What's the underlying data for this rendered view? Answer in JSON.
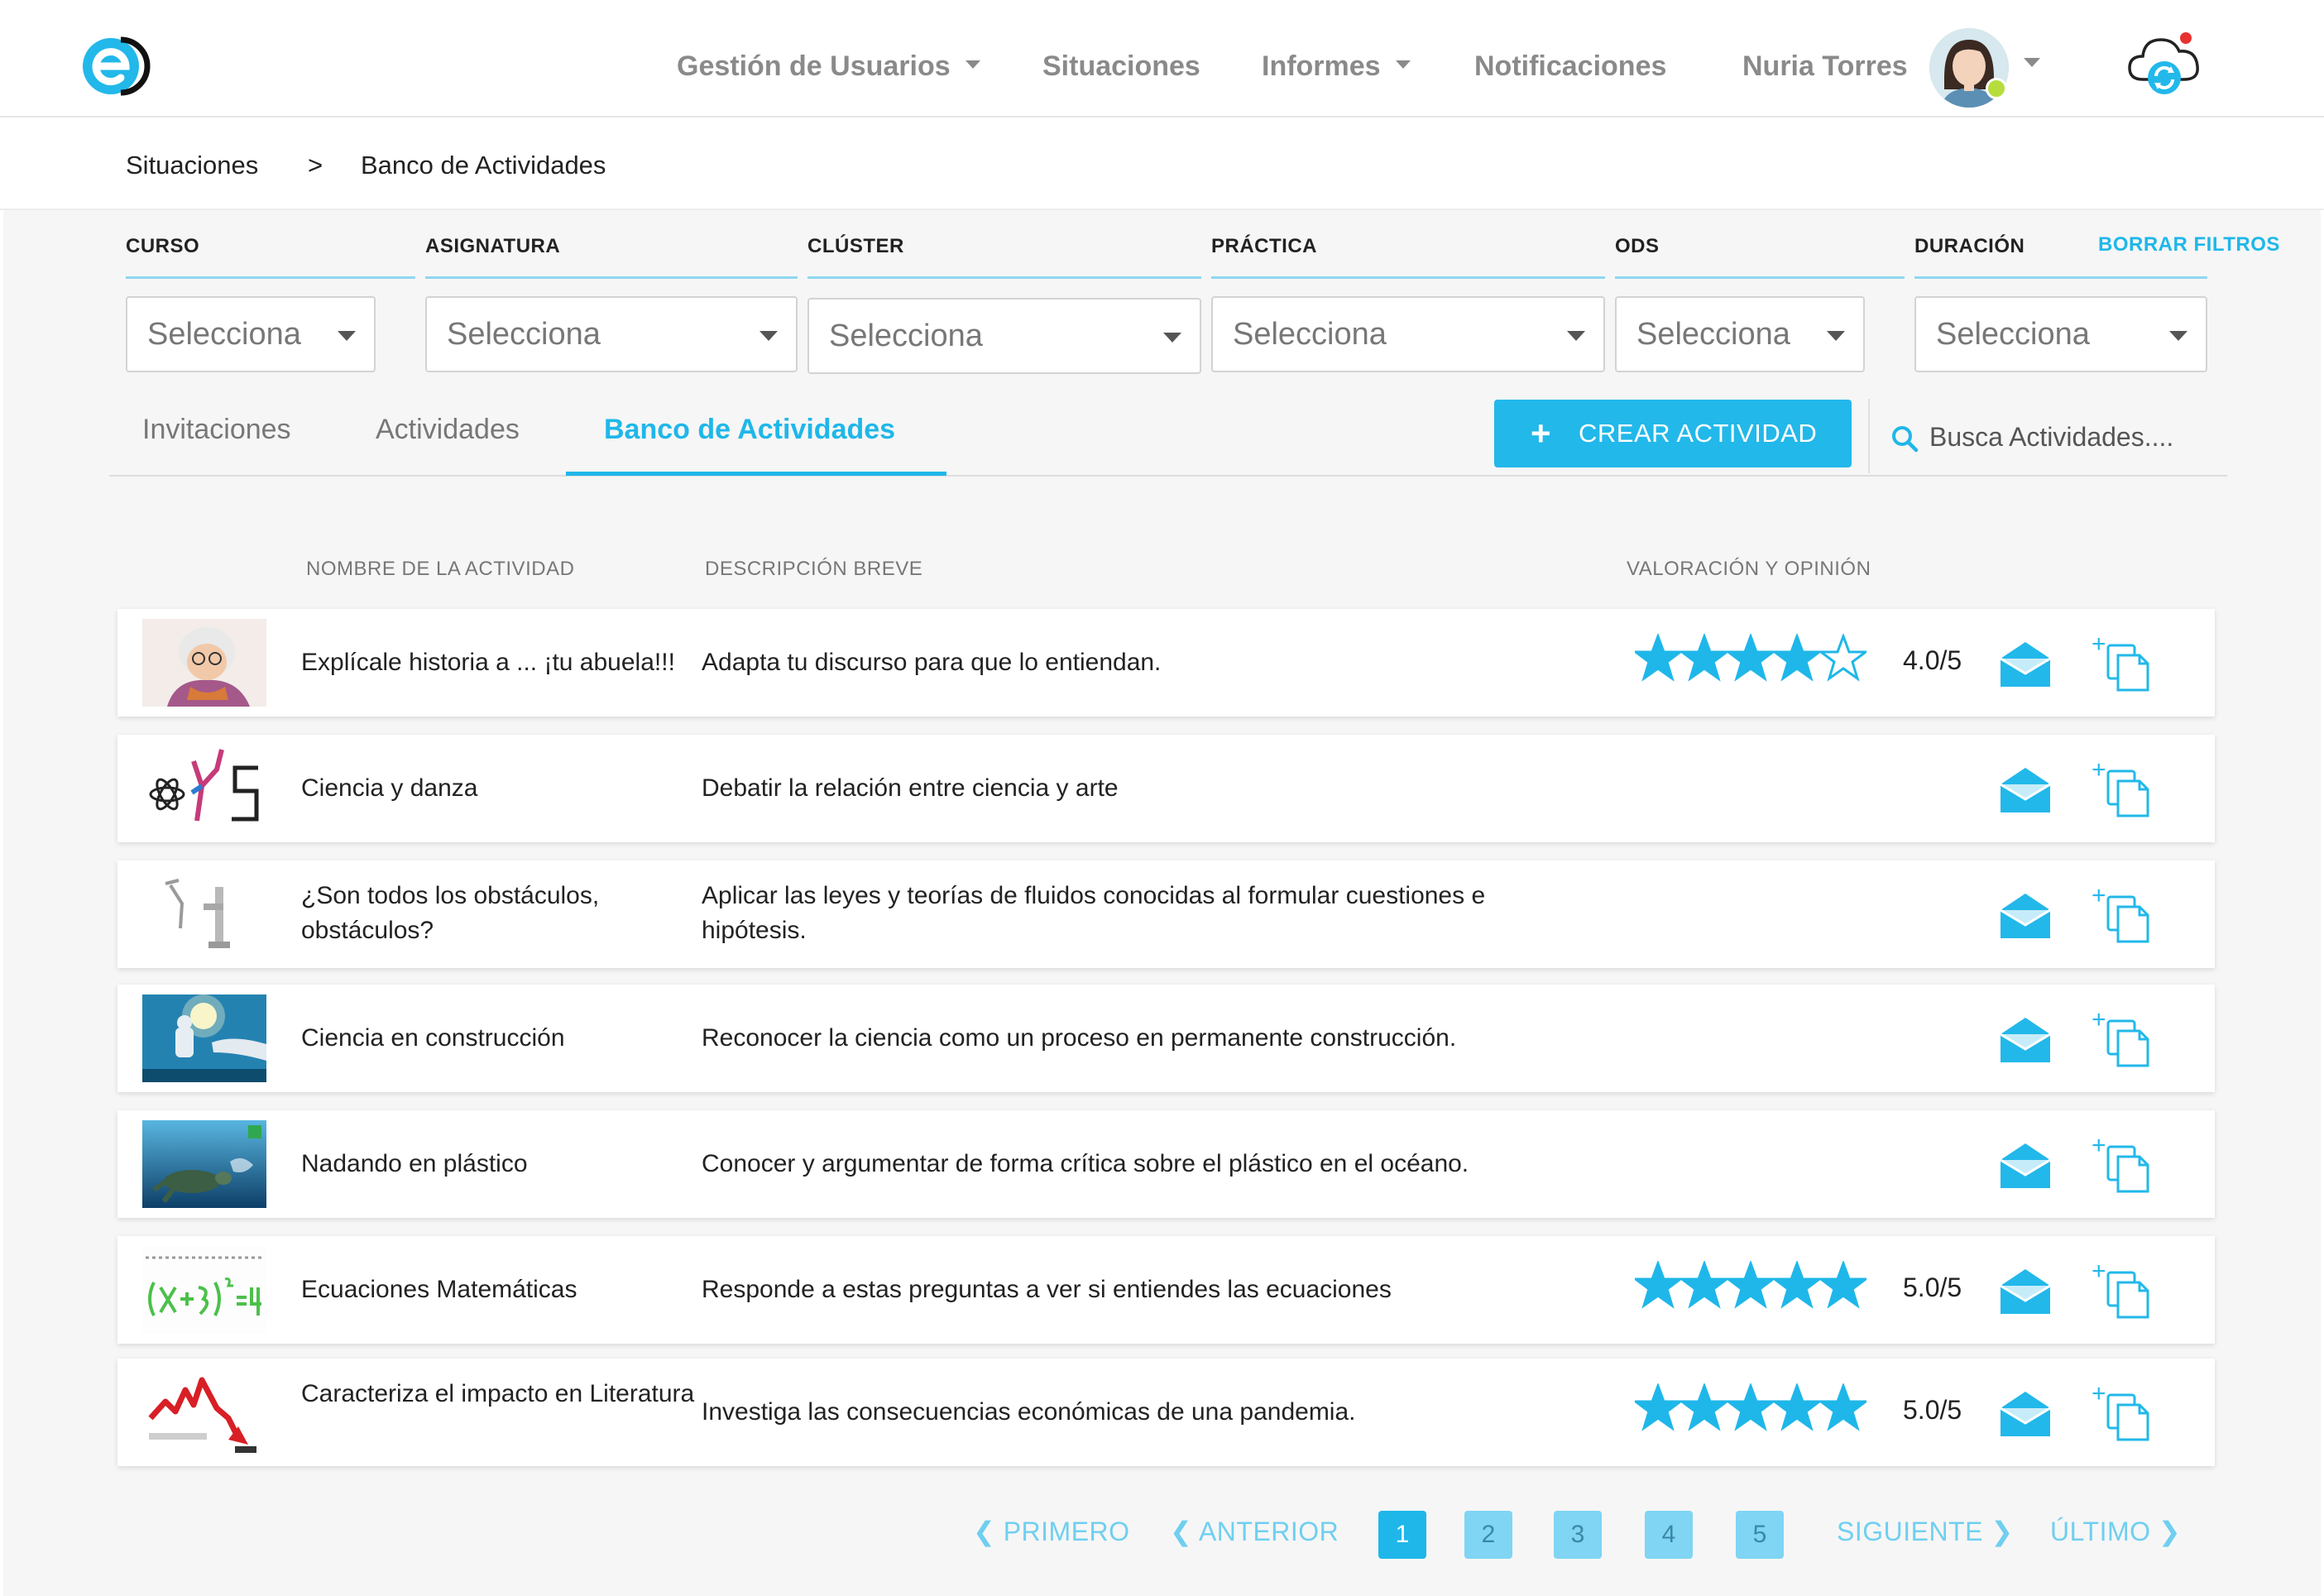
{
  "nav": {
    "items": [
      {
        "label": "Gestión de Usuarios",
        "dropdown": true
      },
      {
        "label": "Situaciones",
        "dropdown": false
      },
      {
        "label": "Informes",
        "dropdown": true
      },
      {
        "label": "Notificaciones",
        "dropdown": false
      }
    ],
    "user_name": "Nuria Torres"
  },
  "breadcrumb": {
    "items": [
      "Situaciones",
      ">",
      "Banco de Actividades"
    ]
  },
  "filters": {
    "labels": [
      "CURSO",
      "ASIGNATURA",
      "CLÚSTER",
      "PRÁCTICA",
      "ODS",
      "DURACIÓN"
    ],
    "placeholder": "Selecciona",
    "clear_label": "BORRAR FILTROS"
  },
  "tabs": {
    "items": [
      "Invitaciones",
      "Actividades",
      "Banco de Actividades"
    ],
    "active": "Banco de Actividades"
  },
  "toolbar": {
    "create_label": "CREAR ACTIVIDAD",
    "search_placeholder": "Busca Actividades...."
  },
  "table": {
    "headers": {
      "name": "NOMBRE DE LA ACTIVIDAD",
      "description": "DESCRIPCIÓN BREVE",
      "rating": "VALORACIÓN Y OPINIÓN"
    },
    "rows": [
      {
        "name": "Explícale historia a ... ¡tu abuela!!!",
        "description": "Adapta tu discurso para que lo entiendan.",
        "rating": 4,
        "rating_label": "4.0/5",
        "thumb": "grandmother-image"
      },
      {
        "name": "Ciencia y danza",
        "description": "Debatir la relación entre ciencia y arte",
        "rating": null,
        "rating_label": "",
        "thumb": "science-dance-image"
      },
      {
        "name": "¿Son todos los obstáculos, obstáculos?",
        "description": "Aplicar las leyes y teorías de fluidos conocidas al formular cuestiones e hipótesis.",
        "rating": null,
        "rating_label": "",
        "thumb": "faucet-image"
      },
      {
        "name": "Ciencia en construcción",
        "description": "Reconocer la ciencia como un proceso en permanente construcción.",
        "rating": null,
        "rating_label": "",
        "thumb": "robot-lightbulb-image"
      },
      {
        "name": "Nadando en plástico",
        "description": "Conocer y argumentar de forma crítica sobre el plástico en el océano.",
        "rating": null,
        "rating_label": "",
        "thumb": "turtle-plastic-image"
      },
      {
        "name": "Ecuaciones Matemáticas",
        "description": "Responde a estas preguntas a ver si entiendes las ecuaciones",
        "rating": 5,
        "rating_label": "5.0/5",
        "thumb": "equation-image"
      },
      {
        "name": "Caracteriza el impacto en Literatura",
        "description": "Investiga las consecuencias económicas de una pandemia.",
        "rating": 5,
        "rating_label": "5.0/5",
        "thumb": "falling-chart-image"
      }
    ]
  },
  "pagination": {
    "first": "PRIMERO",
    "prev": "ANTERIOR",
    "pages": [
      "1",
      "2",
      "3",
      "4",
      "5"
    ],
    "current": "1",
    "next": "SIGUIENTE",
    "last": "ÚLTIMO"
  },
  "colors": {
    "accent": "#1fb7e9",
    "nav_text": "#8a8a8a",
    "row_bg": "#ffffff",
    "page_bg": "#f6f6f6"
  },
  "icons": [
    "logo-icon",
    "cloud-sync-icon",
    "search-icon",
    "mail-icon",
    "copy-add-icon",
    "star-icon",
    "chevron-left-icon",
    "chevron-right-icon"
  ]
}
